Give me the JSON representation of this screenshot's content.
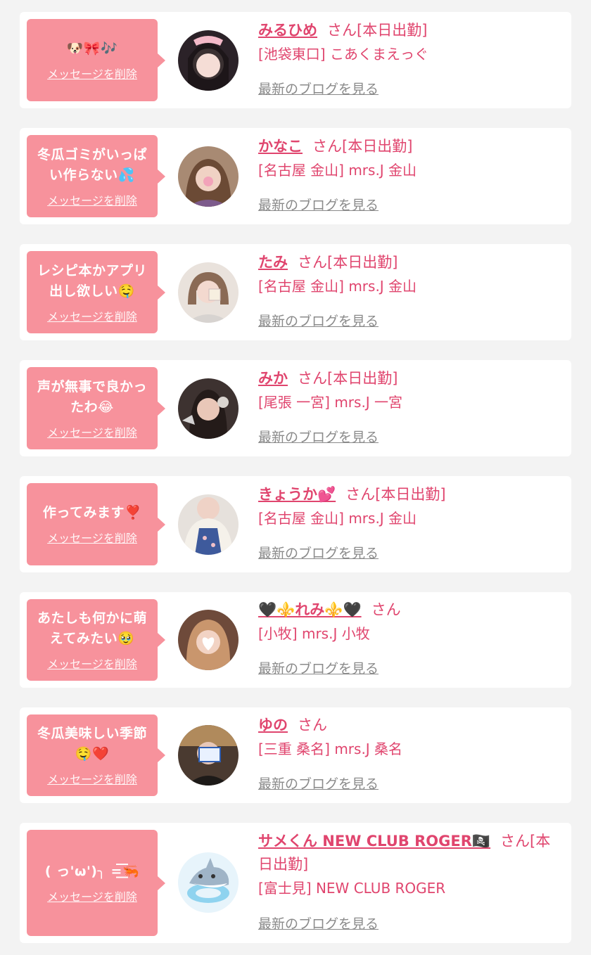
{
  "colors": {
    "accent": "#e0456e",
    "bubble": "#f7929c",
    "blog_link": "#8a8a8a",
    "background": "#f3f3f3"
  },
  "delete_label": "メッセージを削除",
  "blog_label": "最新のブログを見る",
  "items": [
    {
      "message": "🐶🎀🎶",
      "name": "みるひめ",
      "suffix": "さん[本日出勤]",
      "shop": "[池袋東口] こあくまえっぐ",
      "avatar_icon": "girl-photo-avatar"
    },
    {
      "message": "冬瓜ゴミがいっぱい作らない💦",
      "name": "かなこ",
      "suffix": "さん[本日出勤]",
      "shop": "[名古屋 金山] mrs.J 金山",
      "avatar_icon": "girl-photo-avatar"
    },
    {
      "message": "レシピ本かアプリ出し欲しい🤤",
      "name": "たみ",
      "suffix": "さん[本日出勤]",
      "shop": "[名古屋 金山] mrs.J 金山",
      "avatar_icon": "girl-photo-avatar"
    },
    {
      "message": "声が無事で良かったわ😂",
      "name": "みか",
      "suffix": "さん[本日出勤]",
      "shop": "[尾張 一宮] mrs.J 一宮",
      "avatar_icon": "girl-photo-avatar"
    },
    {
      "message": "作ってみます❣️",
      "name": "きょうか💕",
      "suffix": "さん[本日出勤]",
      "shop": "[名古屋 金山] mrs.J 金山",
      "avatar_icon": "girl-photo-avatar"
    },
    {
      "message": "あたしも何かに萌えてみたい🥹",
      "name": "🖤⚜️れみ⚜️🖤",
      "suffix": "さん",
      "shop": "[小牧] mrs.J 小牧",
      "avatar_icon": "girl-photo-avatar"
    },
    {
      "message": "冬瓜美味しい季節🤤❤️",
      "name": "ゆの",
      "suffix": "さん",
      "shop": "[三重 桑名] mrs.J 桑名",
      "avatar_icon": "girl-photo-avatar"
    },
    {
      "message": "( っ'ω')╮ =͟͟͞͞🦐",
      "name": "サメくん NEW CLUB ROGER🏴‍☠️",
      "suffix": "さん[本日出勤]",
      "shop": "[富士見] NEW CLUB ROGER",
      "avatar_icon": "shark-avatar"
    }
  ]
}
